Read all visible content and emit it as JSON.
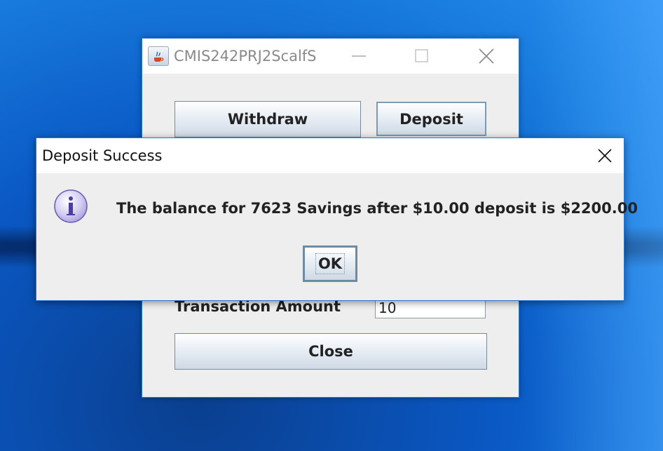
{
  "main_window": {
    "title": "CMIS242PRJ2ScalfS",
    "withdraw_label": "Withdraw",
    "deposit_label": "Deposit",
    "amount_label": "Transaction Amount",
    "amount_value": "10",
    "close_label": "Close"
  },
  "dialog": {
    "title": "Deposit Success",
    "message": "The balance for 7623 Savings after $10.00 deposit is $2200.00",
    "ok_label": "OK"
  },
  "colors": {
    "window_border": "#2b78d0",
    "desktop": "#0a58c4"
  }
}
